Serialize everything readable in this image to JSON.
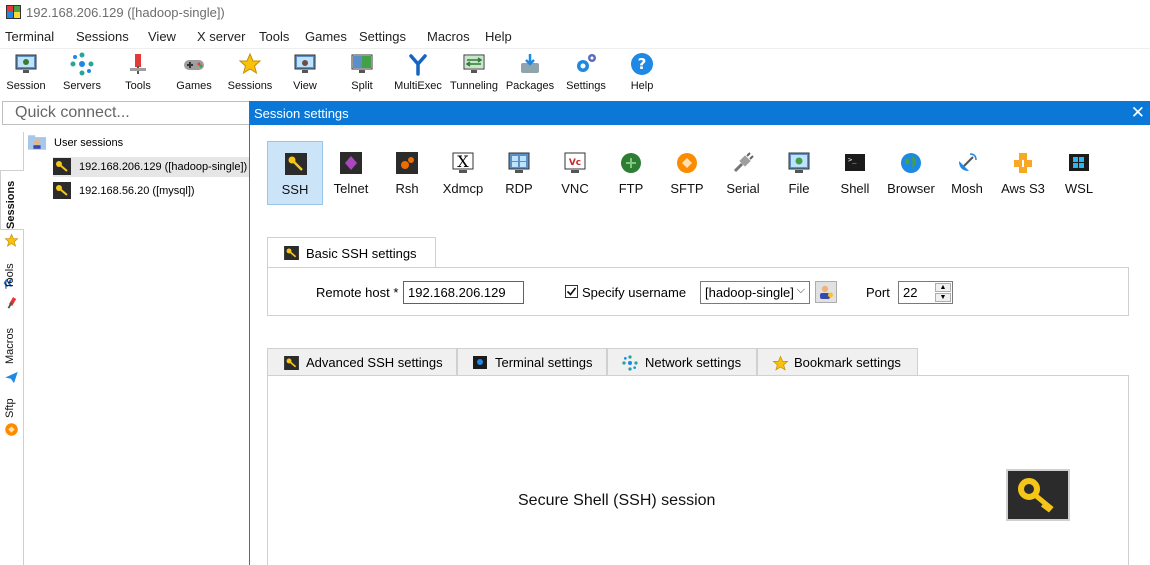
{
  "window": {
    "title": "192.168.206.129 ([hadoop-single])"
  },
  "menu": [
    "Terminal",
    "Sessions",
    "View",
    "X server",
    "Tools",
    "Games",
    "Settings",
    "Macros",
    "Help"
  ],
  "toolbar": [
    "Session",
    "Servers",
    "Tools",
    "Games",
    "Sessions",
    "View",
    "Split",
    "MultiExec",
    "Tunneling",
    "Packages",
    "Settings",
    "Help"
  ],
  "quick_connect": {
    "placeholder": "Quick connect..."
  },
  "side_tabs": [
    "Sessions",
    "Tools",
    "Macros",
    "Sftp"
  ],
  "tree": {
    "root": "User sessions",
    "items": [
      "192.168.206.129 ([hadoop-single])",
      "192.168.56.20 ([mysql])"
    ]
  },
  "dialog": {
    "title": "Session settings",
    "close": "✕",
    "protocols": [
      "SSH",
      "Telnet",
      "Rsh",
      "Xdmcp",
      "RDP",
      "VNC",
      "FTP",
      "SFTP",
      "Serial",
      "File",
      "Shell",
      "Browser",
      "Mosh",
      "Aws S3",
      "WSL"
    ],
    "selected_protocol": "SSH",
    "basic_tab": "Basic SSH settings",
    "remote_host_label": "Remote host *",
    "remote_host_value": "192.168.206.129",
    "specify_username_label": "Specify username",
    "specify_username_checked": true,
    "username_value": "[hadoop-single]",
    "port_label": "Port",
    "port_value": "22",
    "tabs": [
      "Advanced SSH settings",
      "Terminal settings",
      "Network settings",
      "Bookmark settings"
    ],
    "description": "Secure Shell (SSH) session"
  },
  "colors": {
    "accent": "#0b78d7",
    "selected_bg": "#cce4f7"
  }
}
